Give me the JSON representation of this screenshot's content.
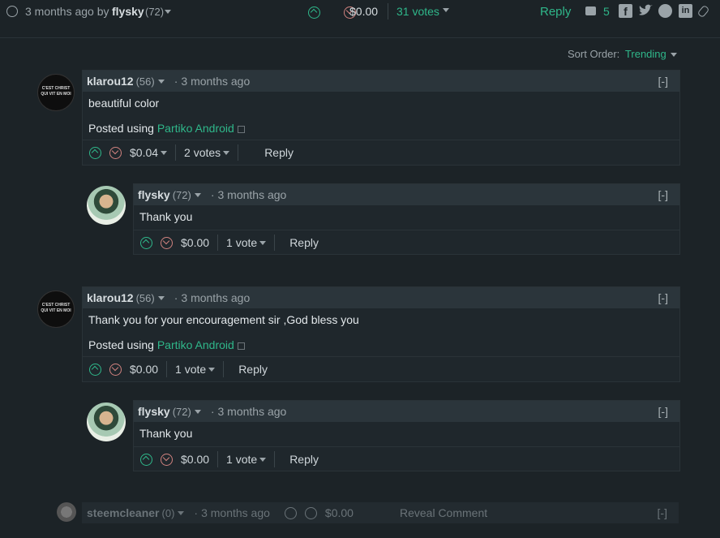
{
  "post_meta": {
    "time_ago": "3 months ago by",
    "author": "flysky",
    "rep": "(72)"
  },
  "post_votes": {
    "payout": "$0.00",
    "votes": "31 votes",
    "reply": "Reply",
    "comment_count": "5"
  },
  "sort": {
    "label": "Sort Order:",
    "value": "Trending"
  },
  "comments": [
    {
      "author": "klarou12",
      "rep": "(56)",
      "time": "3 months ago",
      "toggle": "[-]",
      "body": "beautiful color",
      "posted_using_prefix": "Posted using",
      "posted_using_link": "Partiko Android",
      "payout": "$0.04",
      "votes": "2 votes",
      "reply": "Reply"
    },
    {
      "author": "flysky",
      "rep": "(72)",
      "time": "3 months ago",
      "toggle": "[-]",
      "body": "Thank you",
      "payout": "$0.00",
      "votes": "1 vote",
      "reply": "Reply"
    },
    {
      "author": "klarou12",
      "rep": "(56)",
      "time": "3 months ago",
      "toggle": "[-]",
      "body": "Thank you for your encouragement sir ,God bless you",
      "posted_using_prefix": "Posted using",
      "posted_using_link": "Partiko Android",
      "payout": "$0.00",
      "votes": "1 vote",
      "reply": "Reply"
    },
    {
      "author": "flysky",
      "rep": "(72)",
      "time": "3 months ago",
      "toggle": "[-]",
      "body": "Thank you",
      "payout": "$0.00",
      "votes": "1 vote",
      "reply": "Reply"
    }
  ],
  "hidden_comment": {
    "author": "steemcleaner",
    "rep": "(0)",
    "time": "3 months ago",
    "payout": "$0.00",
    "reveal": "Reveal Comment",
    "toggle": "[-]"
  },
  "avatar_text": {
    "line1": "C'EST CHRIST",
    "line2": "QUI VIT EN MOI"
  },
  "colors": {
    "accent": "#2fb78a",
    "background": "#1c2327",
    "header": "#2b353b"
  }
}
